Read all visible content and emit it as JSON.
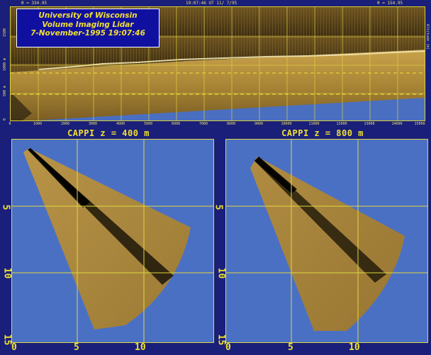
{
  "top": {
    "left_header": "θ = 334.95",
    "center_header": "19:07:46 UT 11/ 7/95",
    "right_header": "θ = 154.95",
    "title_line1": "University of Wisconsin",
    "title_line2": "Volume Imaging Lidar",
    "title_line3": "7-November-1995 19:07:46",
    "x_ticks": [
      "0",
      "1000",
      "2000",
      "3000",
      "4000",
      "5000",
      "6000",
      "7000",
      "8000",
      "9000",
      "10000",
      "11000",
      "12000",
      "13000",
      "14000",
      "15000"
    ],
    "y_ticks": [
      "0",
      "500 m",
      "1000 m",
      "1500"
    ],
    "right_label": "Altitude (m)"
  },
  "cappi_left": {
    "title": "CAPPI  z = 400 m",
    "y_ticks": [
      "5",
      "10",
      "15"
    ],
    "x_ticks": [
      "0",
      "5",
      "10"
    ]
  },
  "cappi_right": {
    "title": "CAPPI  z = 800 m",
    "y_ticks": [
      "5",
      "10",
      "15"
    ],
    "x_ticks": [
      "0",
      "5",
      "10"
    ]
  },
  "colors": {
    "background": "#1a1f7a",
    "sky": "#4a6fc0",
    "grid": "#e0d840",
    "text": "#f0e030",
    "aerosol": "#b08a3c"
  }
}
